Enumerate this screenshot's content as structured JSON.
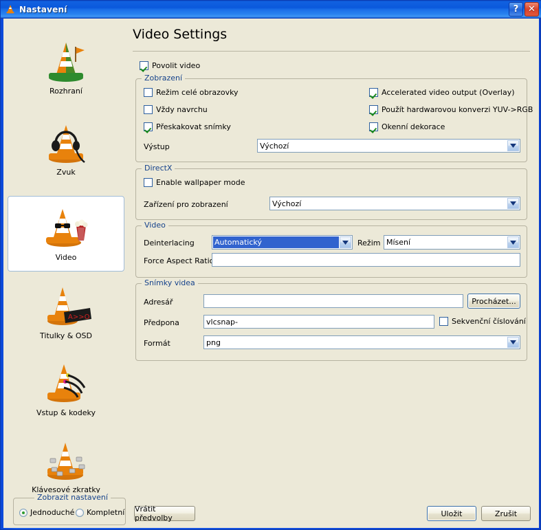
{
  "window": {
    "title": "Nastavení",
    "icon": "vlc-cone-icon",
    "help_button": "?",
    "close_button": "✕"
  },
  "sidebar": {
    "items": [
      {
        "label": "Rozhraní",
        "icon": "cone-interface-icon",
        "selected": false
      },
      {
        "label": "Zvuk",
        "icon": "cone-headphones-icon",
        "selected": false
      },
      {
        "label": "Video",
        "icon": "cone-glasses-popcorn-icon",
        "selected": true
      },
      {
        "label": "Titulky & OSD",
        "icon": "cone-osd-icon",
        "selected": false
      },
      {
        "label": "Vstup & kodeky",
        "icon": "cone-cables-icon",
        "selected": false
      },
      {
        "label": "Klávesové zkratky",
        "icon": "cone-keys-icon",
        "selected": false
      }
    ]
  },
  "mode_group": {
    "legend": "Zobrazit nastavení",
    "options": [
      {
        "label": "Jednoduché",
        "selected": true
      },
      {
        "label": "Kompletní",
        "selected": false
      }
    ]
  },
  "buttons": {
    "reset": "Vrátit předvolby",
    "save": "Uložit",
    "cancel": "Zrušit",
    "browse": "Procházet..."
  },
  "main": {
    "title": "Video Settings",
    "enable_video": {
      "label": "Povolit video",
      "checked": true
    },
    "display_group": {
      "legend": "Zobrazení",
      "left_checkboxes": [
        {
          "label": "Režim celé obrazovky",
          "checked": false
        },
        {
          "label": "Vždy navrchu",
          "checked": false
        },
        {
          "label": "Přeskakovat snímky",
          "checked": true
        }
      ],
      "right_checkboxes": [
        {
          "label": "Accelerated video output (Overlay)",
          "checked": true
        },
        {
          "label": "Použít hardwarovou konverzi YUV->RGB",
          "checked": true
        },
        {
          "label": "Okenní dekorace",
          "checked": true
        }
      ],
      "output": {
        "label": "Výstup",
        "value": "Výchozí"
      }
    },
    "directx_group": {
      "legend": "DirectX",
      "wallpaper": {
        "label": "Enable wallpaper mode",
        "checked": false
      },
      "device": {
        "label": "Zařízení pro zobrazení",
        "value": "Výchozí"
      }
    },
    "video_group": {
      "legend": "Video",
      "deinterlacing": {
        "label": "Deinterlacing",
        "value": "Automatický",
        "focused": true
      },
      "mode": {
        "label": "Režim",
        "value": "Mísení"
      },
      "aspect": {
        "label": "Force Aspect Ratio",
        "value": "",
        "placeholder": ""
      }
    },
    "snapshot_group": {
      "legend": "Snímky videa",
      "directory": {
        "label": "Adresář",
        "value": "",
        "placeholder": ""
      },
      "prefix": {
        "label": "Předpona",
        "value": "vlcsnap-",
        "placeholder": ""
      },
      "sequential": {
        "label": "Sekvenční číslování",
        "checked": false
      },
      "format": {
        "label": "Formát",
        "value": "png"
      }
    }
  },
  "colors": {
    "titlebar_blue": "#0a58dc",
    "dialog_bg": "#ece9d8",
    "group_legend": "#15428b",
    "check_green": "#1a8a1a",
    "selection_blue": "#3163ce",
    "close_red": "#d6422a"
  }
}
